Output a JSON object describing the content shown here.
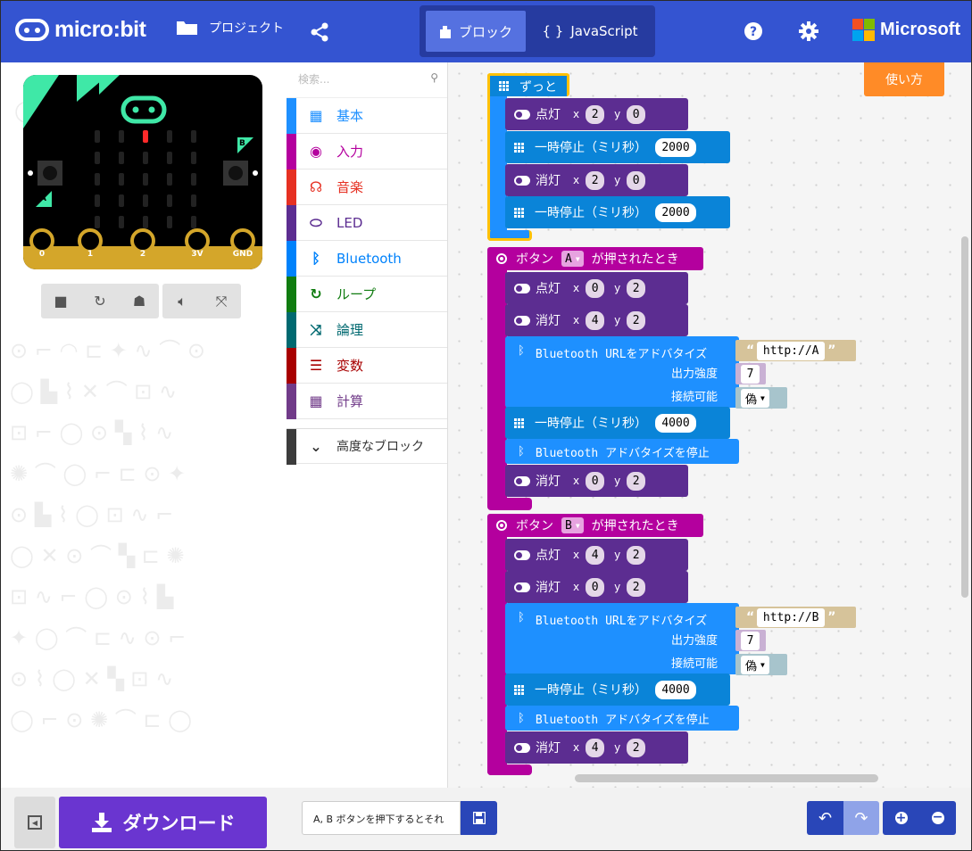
{
  "header": {
    "logo": "micro:bit",
    "projects": "プロジェクト",
    "modes": {
      "blocks": "ブロック",
      "js": "JavaScript"
    },
    "brand": "Microsoft",
    "ms_colors": [
      "#f25022",
      "#7fba00",
      "#00a4ef",
      "#ffb900"
    ]
  },
  "board": {
    "pins": [
      "0",
      "1",
      "2",
      "3V",
      "GND"
    ],
    "btnA": "A",
    "btnB": "B"
  },
  "toolbox": {
    "search_placeholder": "検索...",
    "categories": [
      {
        "label": "基本",
        "color": "#1e90ff",
        "icon": "grid-icon"
      },
      {
        "label": "入力",
        "color": "#b4009e",
        "icon": "target-icon"
      },
      {
        "label": "音楽",
        "color": "#e63022",
        "icon": "headphones-icon"
      },
      {
        "label": "LED",
        "color": "#5c2d91",
        "icon": "toggle-icon"
      },
      {
        "label": "Bluetooth",
        "color": "#0082fb",
        "icon": "bluetooth-icon"
      },
      {
        "label": "ループ",
        "color": "#107c10",
        "icon": "refresh-icon"
      },
      {
        "label": "論理",
        "color": "#006970",
        "icon": "shuffle-icon"
      },
      {
        "label": "変数",
        "color": "#a80000",
        "icon": "list-icon"
      },
      {
        "label": "計算",
        "color": "#713b89",
        "icon": "calculator-icon"
      }
    ],
    "advanced": "高度なブロック"
  },
  "help": "使い方",
  "blocks": {
    "forever": "ずっと",
    "plot": "点灯",
    "unplot": "消灯",
    "x": "x",
    "y": "y",
    "pause": "一時停止（ミリ秒）",
    "pause_val": "2000",
    "pause_val2": "4000",
    "v0": "0",
    "v2": "2",
    "v4": "4",
    "onbutton": "ボタン",
    "pressed": "が押されたとき",
    "btnA": "A",
    "btnB": "B",
    "bturl": "Bluetooth URLをアドバタイズ",
    "urlA": "http://A",
    "urlB": "http://B",
    "power": "出力強度",
    "powval": "7",
    "connectable": "接続可能",
    "false": "偽",
    "stopadv": "Bluetooth アドバタイズを停止"
  },
  "footer": {
    "download": "ダウンロード",
    "project_name": "A, B ボタンを押下するとそれ"
  }
}
